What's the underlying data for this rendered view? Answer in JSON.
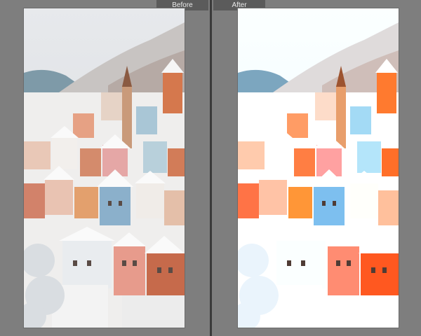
{
  "compare": {
    "before_label": "Before",
    "after_label": "After"
  },
  "colors": {
    "window_bg": "#7e7e7e",
    "divider": "#3a3a3a",
    "label_bg": "#5b5b5b",
    "label_text": "#e8e8e8"
  }
}
